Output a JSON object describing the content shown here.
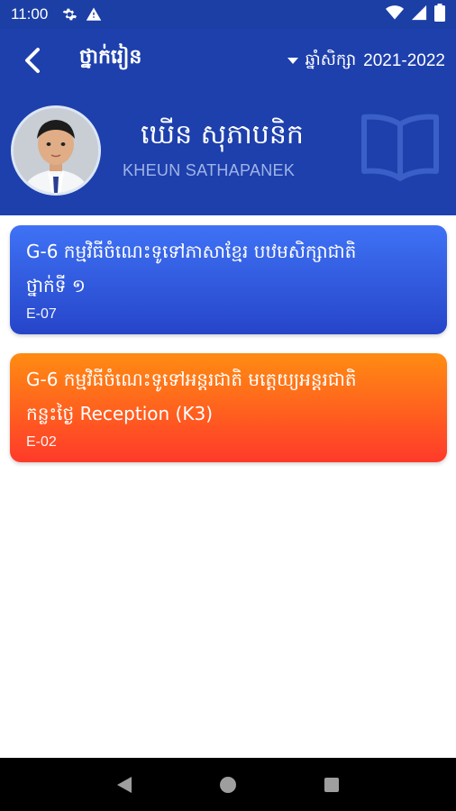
{
  "status_bar": {
    "time": "11:00",
    "icons": [
      "gear-icon",
      "alert-icon",
      "wifi-icon",
      "signal-icon",
      "battery-icon"
    ]
  },
  "app_bar": {
    "title": "ថ្នាក់រៀន",
    "year_label": "ឆ្នាំសិក្សា",
    "year_value": "2021-2022"
  },
  "profile": {
    "name_khmer": "ឃើន សុភាបនិក",
    "name_latin": "KHEUN SATHAPANEK"
  },
  "classes": [
    {
      "title_line1": "G-6 កម្មវិធីចំណេះទូទៅភាសាខ្មែរ បឋមសិក្សាជាតិ",
      "title_line2": "ថ្នាក់ទី ១",
      "code": "E-07",
      "color": "blue"
    },
    {
      "title_line1": "G-6 កម្មវិធីចំណេះទូទៅអន្តរជាតិ មត្តេយ្យអន្តរជាតិ",
      "title_line2": "កន្លះថ្ងៃ Reception (K3)",
      "code": "E-02",
      "color": "orange"
    }
  ],
  "colors": {
    "header": "#1e40ad",
    "status_bar": "#1c3fa6",
    "card_blue": "#3160e8",
    "card_orange": "#ff6a1e"
  }
}
